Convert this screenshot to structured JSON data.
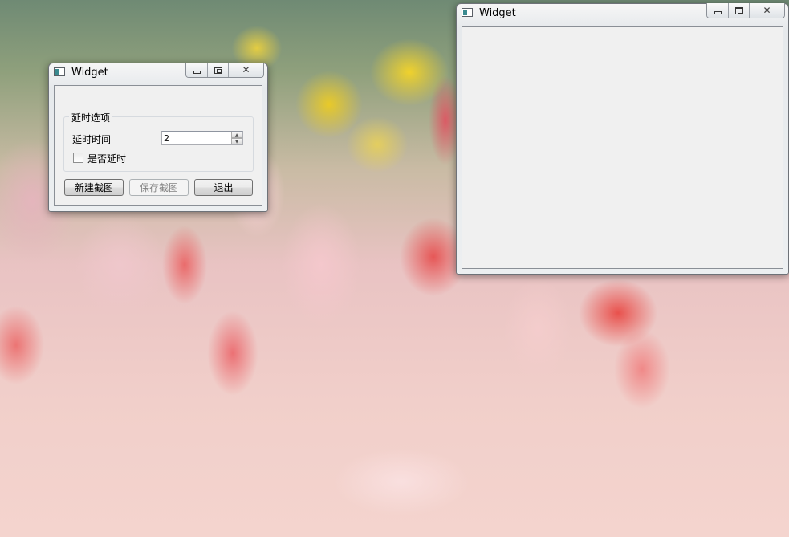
{
  "window_left": {
    "title": "Widget",
    "groupbox_title": "延时选项",
    "delay_label": "延时时间",
    "delay_value": "2",
    "delay_checkbox_label": "是否延时",
    "delay_checked": false,
    "new_button_label": "新建截图",
    "save_button_label": "保存截图",
    "save_enabled": false,
    "exit_button_label": "退出"
  },
  "window_right": {
    "title": "Widget"
  },
  "caption_glyphs": {
    "close": "✕"
  }
}
